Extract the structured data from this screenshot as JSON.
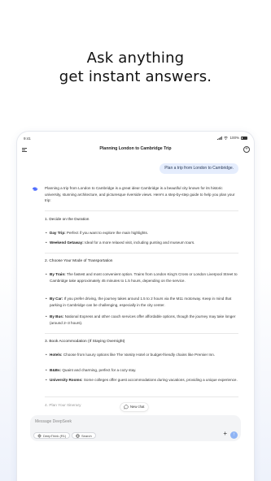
{
  "hero": {
    "line1": "Ask anything",
    "line2": "get instant answers."
  },
  "status_bar": {
    "time": "9:41",
    "battery": "100%"
  },
  "header": {
    "title": "Planning London to Cambridge Trip",
    "menu_icon": "hamburger-icon",
    "new_chat_icon": "new-chat-icon"
  },
  "user_message": "Plan a trip from London to Cambridge.",
  "assistant": {
    "intro": "Planning a trip from London to Cambridge is a great idea! Cambridge is a beautiful city known for its historic university, stunning architecture, and picturesque riverside views. Here's a step-by-step guide to help you plan your trip:",
    "sections": [
      {
        "title": "1. Decide on the Duration",
        "items": [
          {
            "label": "Day Trip:",
            "text": " Perfect if you want to explore the main highlights."
          },
          {
            "label": "Weekend Getaway:",
            "text": " Ideal for a more relaxed visit, including punting and museum tours."
          }
        ]
      },
      {
        "title": "2. Choose Your Mode of Transportation",
        "items": [
          {
            "label": "By Train:",
            "text": " The fastest and most convenient option. Trains from London King's Cross or London Liverpool Street to Cambridge take approximately 45 minutes to 1.5 hours, depending on the service."
          },
          {
            "label": "By Car:",
            "text": " If you prefer driving, the journey takes around 1.5 to 2 hours via the M11 motorway. Keep in mind that parking in Cambridge can be challenging, especially in the city center."
          },
          {
            "label": "By Bus:",
            "text": " National Express and other coach services offer affordable options, though the journey may take longer (around 2–3 hours)."
          }
        ]
      },
      {
        "title": "3. Book Accommodation (If Staying Overnight)",
        "items": [
          {
            "label": "Hotels:",
            "text": " Choose from luxury options like The Varsity Hotel or budget-friendly chains like Premier Inn."
          },
          {
            "label": "B&Bs:",
            "text": " Quaint and charming, perfect for a cozy stay."
          },
          {
            "label": "University Rooms:",
            "text": " Some colleges offer guest accommodations during vacations, providing a unique experience."
          }
        ]
      },
      {
        "title": "4. Plan Your Itinerary",
        "items": []
      }
    ]
  },
  "new_chat_button": "New chat",
  "composer": {
    "placeholder": "Message DeepSeek",
    "deepthink_label": "DeepThink (R1)",
    "search_label": "Search",
    "send_color": "#8fb4f5"
  },
  "colors": {
    "accent": "#4d6bfe",
    "user_bubble": "#e5edfd"
  }
}
